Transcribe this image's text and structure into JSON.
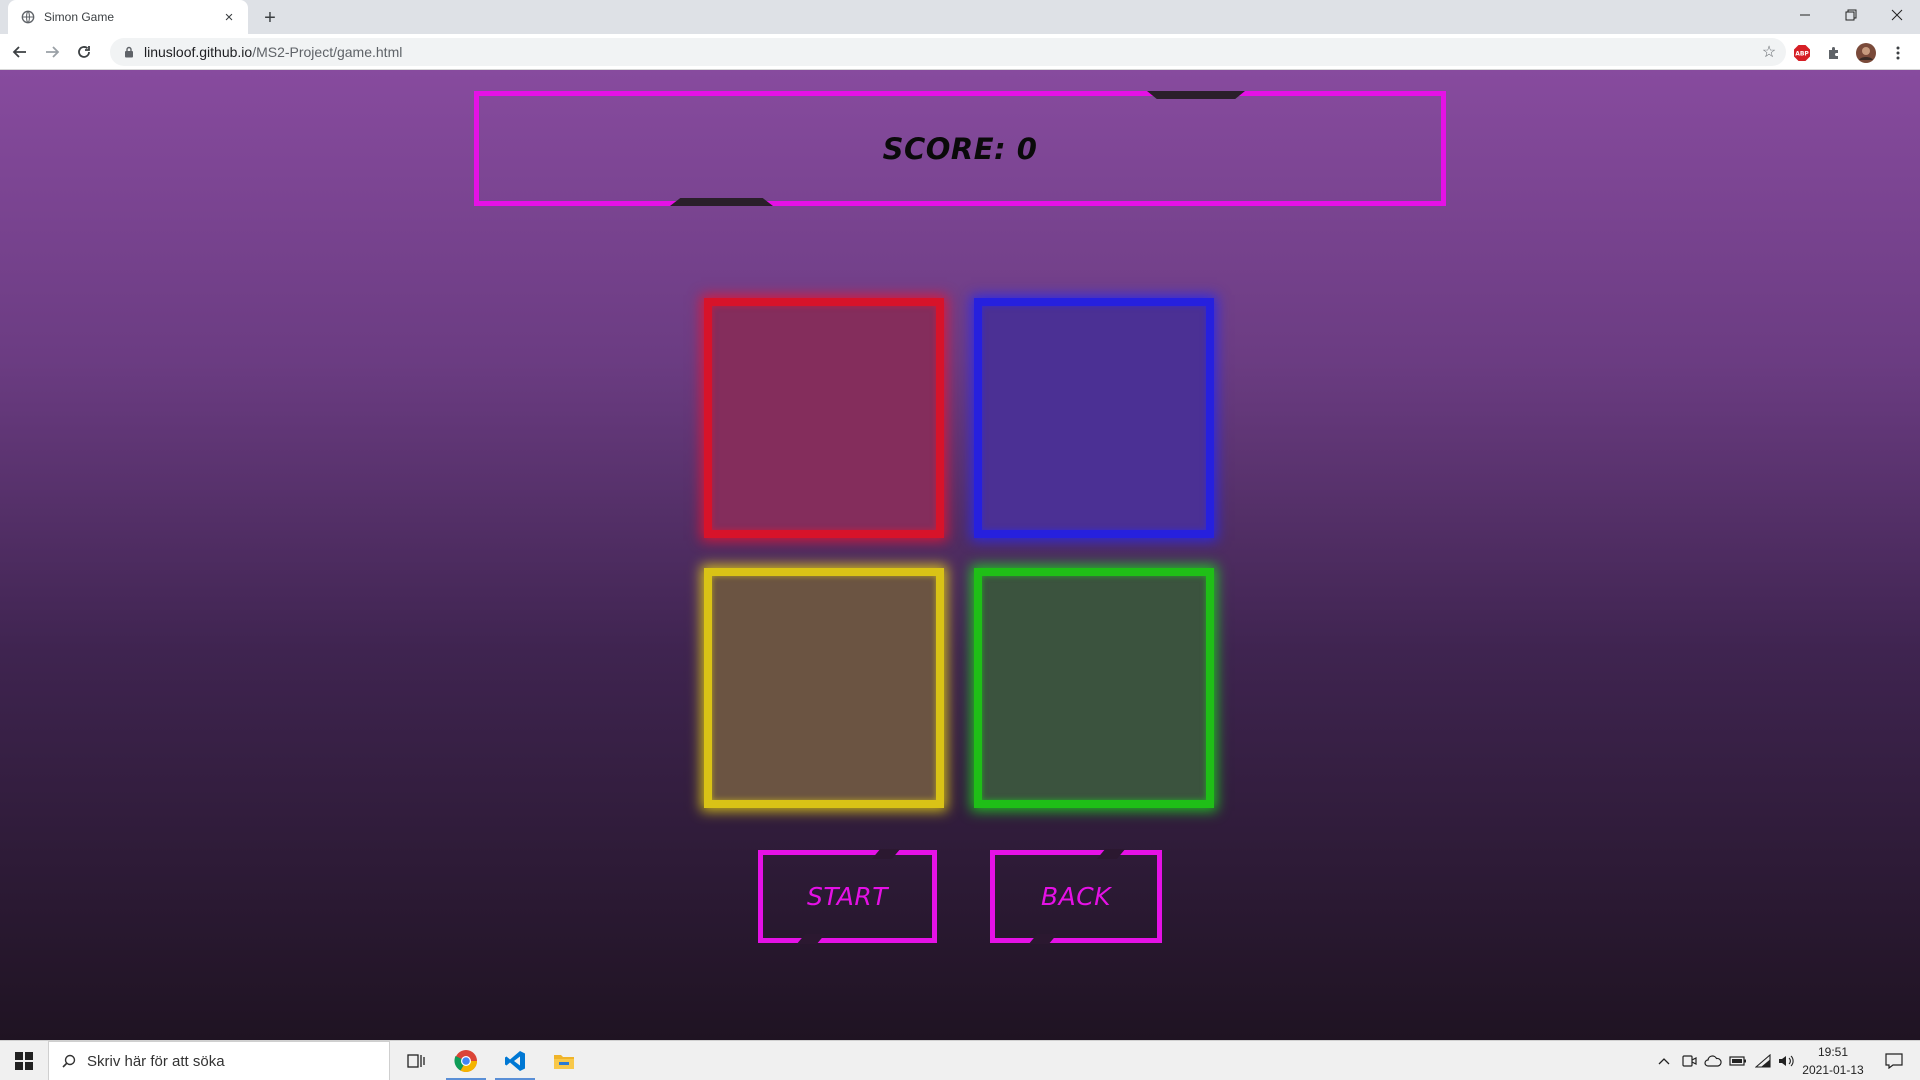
{
  "browser": {
    "tab_title": "Simon Game",
    "tab_close": "×",
    "new_tab": "+",
    "url_host": "linusloof.github.io",
    "url_path": "/MS2-Project/game.html",
    "bookmark_star": "☆",
    "window_controls": {
      "minimize": "—",
      "restore": "❐",
      "close": "✕"
    },
    "extensions": [
      "adblock-plus-icon",
      "puzzle-extension-icon",
      "profile-avatar",
      "menu-kebab-icon"
    ]
  },
  "page": {
    "score_text": "SCORE: 0",
    "accent_color": "#e511e6",
    "pads": [
      {
        "color_name": "red",
        "border": "#d7132a"
      },
      {
        "color_name": "blue",
        "border": "#2620de"
      },
      {
        "color_name": "yellow",
        "border": "#d9c316"
      },
      {
        "color_name": "green",
        "border": "#1fbf17"
      }
    ],
    "start_label": "START",
    "back_label": "BACK"
  },
  "taskbar": {
    "search_placeholder": "Skriv här för att söka",
    "time": "19:51",
    "date": "2021-01-13",
    "pinned": [
      "task-view-icon",
      "chrome-icon",
      "vscode-icon",
      "file-explorer-icon"
    ],
    "tray": [
      "chevron-up-icon",
      "meet-now-icon",
      "onedrive-icon",
      "battery-icon",
      "wifi-icon",
      "volume-icon",
      "notifications-icon"
    ]
  }
}
